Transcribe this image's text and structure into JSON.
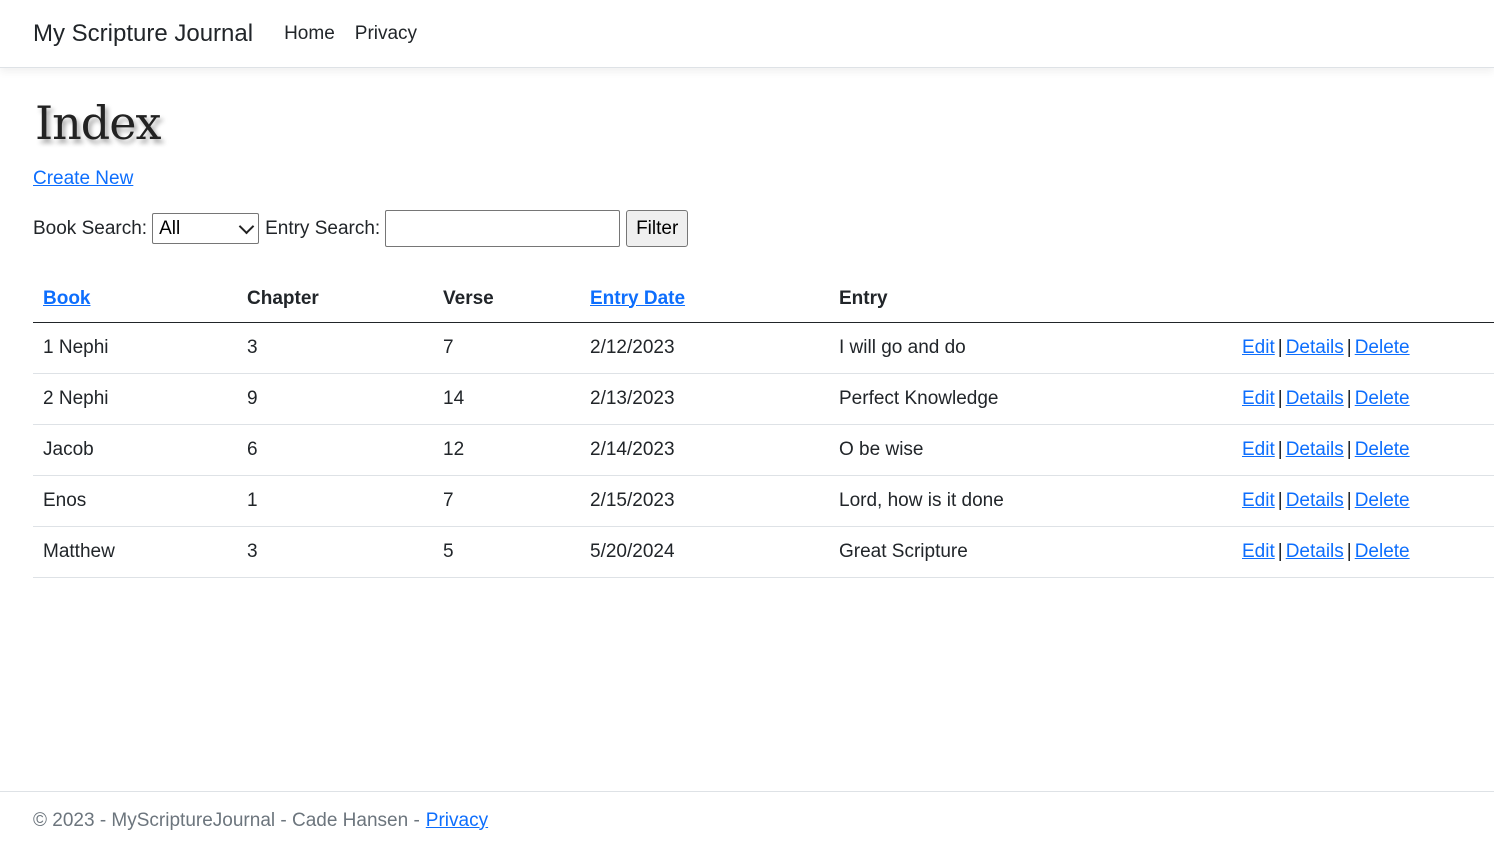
{
  "nav": {
    "brand": "My Scripture Journal",
    "links": [
      "Home",
      "Privacy"
    ]
  },
  "page": {
    "title": "Index",
    "create_link": "Create New"
  },
  "filter": {
    "book_label": "Book Search:",
    "book_selected": "All",
    "entry_label": "Entry Search:",
    "entry_value": "",
    "button_label": "Filter"
  },
  "table": {
    "headers": [
      "Book",
      "Chapter",
      "Verse",
      "Entry Date",
      "Entry"
    ],
    "rows": [
      [
        "1 Nephi",
        "3",
        "7",
        "2/12/2023",
        "I will go and do"
      ],
      [
        "2 Nephi",
        "9",
        "14",
        "2/13/2023",
        "Perfect Knowledge"
      ],
      [
        "Jacob",
        "6",
        "12",
        "2/14/2023",
        "O be wise"
      ],
      [
        "Enos",
        "1",
        "7",
        "2/15/2023",
        "Lord, how is it done"
      ],
      [
        "Matthew",
        "3",
        "5",
        "5/20/2024",
        "Great Scripture"
      ]
    ],
    "actions": [
      "Edit",
      "Details",
      "Delete"
    ],
    "separator": "|"
  },
  "footer": {
    "text": "© 2023 - MyScriptureJournal - Cade Hansen -",
    "link": "Privacy"
  }
}
